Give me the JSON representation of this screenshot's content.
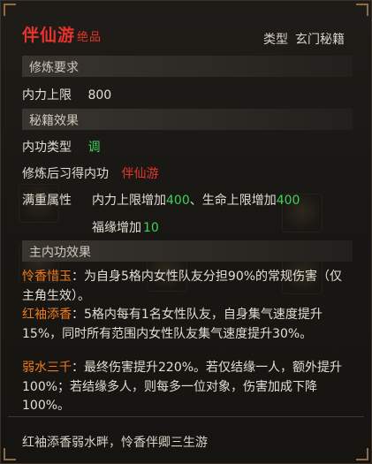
{
  "item": {
    "name": "伴仙游",
    "grade": "绝品",
    "type_label": "类型",
    "type_value": "玄门秘籍"
  },
  "requirements": {
    "header": "修炼要求",
    "inner_power_label": "内力上限",
    "inner_power_value": "800"
  },
  "effects": {
    "header": "秘籍效果",
    "neigong_type_label": "内功类型",
    "neigong_type_value": "调",
    "learned_label": "修炼后习得内功",
    "learned_value": "伴仙游",
    "full_attr_label": "满重属性",
    "attr1_text": "内力上限增加",
    "attr1_value": "400",
    "sep": "、",
    "attr2_text": "生命上限增加",
    "attr2_value": "400",
    "attr3_text": "福缘增加",
    "attr3_value": "10"
  },
  "main_effects": {
    "header": "主内功效果",
    "items": [
      {
        "name": "怜香惜玉",
        "text": "：为自身5格内女性队友分担90%的常规伤害（仅主角生效）。"
      },
      {
        "name": "红袖添香",
        "text": "：5格内每有1名女性队友，自身集气速度提升15%，同时所有范围内女性队友集气速度提升30%。"
      },
      {
        "name": "弱水三千",
        "text": "：最终伤害提升220%。若仅结缘一人，额外提升100%；若结缘多人，则每多一位对象，伤害加成下降100%。"
      }
    ]
  },
  "poem": "红袖添香弱水畔，怜香伴卿三生游",
  "colors": {
    "red": "#e8332c",
    "green": "#3fd05a",
    "orange": "#f07a1a"
  }
}
